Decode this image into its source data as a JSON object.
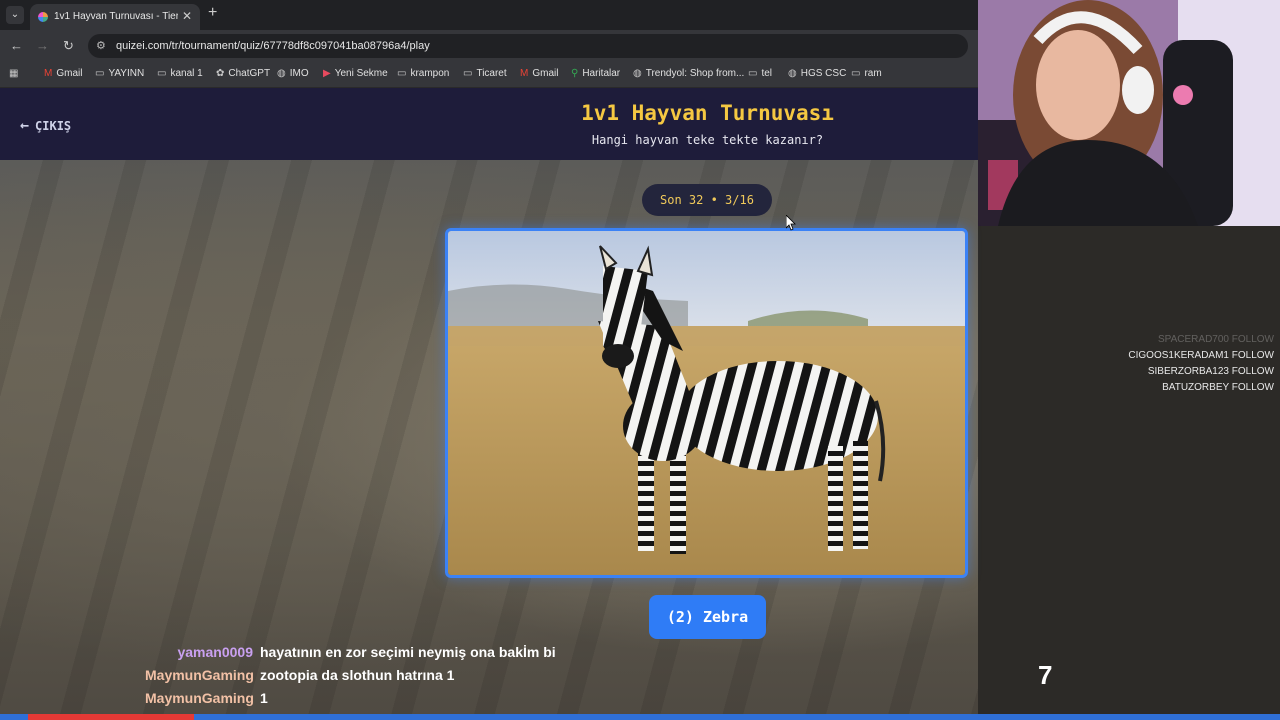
{
  "browser": {
    "tab_title": "1v1 Hayvan Turnuvası - Tier List",
    "tab_close": "✕",
    "new_tab": "+",
    "url": "quizei.com/tr/tournament/quiz/67778df8c097041ba08796a4/play",
    "bookmarks": [
      {
        "label": "Gmail",
        "icon": "gmail-icon"
      },
      {
        "label": "YAYINN",
        "icon": "folder-icon"
      },
      {
        "label": "kanal 1",
        "icon": "folder-icon"
      },
      {
        "label": "ChatGPT",
        "icon": "chatgpt-icon"
      },
      {
        "label": "IMO",
        "icon": "globe-icon"
      },
      {
        "label": "Yeni Sekme",
        "icon": "play-icon"
      },
      {
        "label": "krampon",
        "icon": "folder-icon"
      },
      {
        "label": "Ticaret",
        "icon": "folder-icon"
      },
      {
        "label": "Gmail",
        "icon": "gmail-icon"
      },
      {
        "label": "Haritalar",
        "icon": "maps-icon"
      },
      {
        "label": "Trendyol: Shop from...",
        "icon": "globe-icon"
      },
      {
        "label": "tel",
        "icon": "folder-icon"
      },
      {
        "label": "HGS CSC",
        "icon": "globe-icon"
      },
      {
        "label": "ram",
        "icon": "folder-icon"
      }
    ]
  },
  "page": {
    "exit_label": "ÇIKIŞ",
    "title": "1v1 Hayvan Turnuvası",
    "subtitle": "Hangi hayvan teke tekte kazanır?",
    "round_label": "Son 32 • 3/16",
    "choice_label": "(2) Zebra",
    "accent_color": "#3b82f6",
    "title_color": "#f5c842"
  },
  "stream": {
    "follows": [
      {
        "name": "SPACERAD700",
        "action": "FOLLOW"
      },
      {
        "name": "CIGOOS1KERADAM1",
        "action": "FOLLOW"
      },
      {
        "name": "SIBERZORBA123",
        "action": "FOLLOW"
      },
      {
        "name": "BATUZORBEY",
        "action": "FOLLOW"
      }
    ],
    "chat": [
      {
        "user": "yaman0009",
        "msg": "hayatının en zor seçimi neymiş ona bakİm bi",
        "color": "#c9a0f0"
      },
      {
        "user": "MaymunGaming",
        "msg": "zootopia da slothun hatrına 1",
        "color": "#f2c1a6"
      },
      {
        "user": "MaymunGaming",
        "msg": "1",
        "color": "#f2c1a6"
      }
    ],
    "counter": "7",
    "progress_fraction": 0.13
  }
}
